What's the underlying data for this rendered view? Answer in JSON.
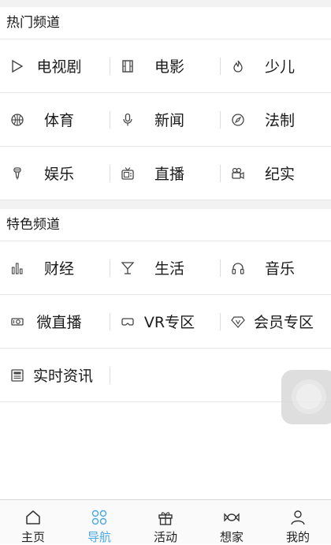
{
  "hot_section": {
    "title": "热门频道",
    "rows": [
      [
        {
          "label": "电视剧",
          "icon": "play-icon"
        },
        {
          "label": "电影",
          "icon": "film-icon"
        },
        {
          "label": "少儿",
          "icon": "flame-icon"
        }
      ],
      [
        {
          "label": "体育",
          "icon": "basketball-icon"
        },
        {
          "label": "新闻",
          "icon": "microphone-icon"
        },
        {
          "label": "法制",
          "icon": "compass-icon"
        }
      ],
      [
        {
          "label": "娱乐",
          "icon": "karaoke-mic-icon"
        },
        {
          "label": "直播",
          "icon": "tv-icon"
        },
        {
          "label": "纪实",
          "icon": "video-camera-icon"
        }
      ]
    ]
  },
  "featured_section": {
    "title": "特色频道",
    "rows": [
      [
        {
          "label": "财经",
          "icon": "bar-chart-icon"
        },
        {
          "label": "生活",
          "icon": "cocktail-glass-icon"
        },
        {
          "label": "音乐",
          "icon": "headphones-icon"
        }
      ],
      [
        {
          "label": "微直播",
          "icon": "camera-box-icon"
        },
        {
          "label": "VR专区",
          "icon": "vr-goggles-icon"
        },
        {
          "label": "会员专区",
          "icon": "vip-diamond-icon"
        }
      ],
      [
        {
          "label": "实时资讯",
          "icon": "newspaper-icon"
        }
      ]
    ]
  },
  "tabbar": {
    "tabs": [
      {
        "label": "主页",
        "icon": "home-icon",
        "active": false
      },
      {
        "label": "导航",
        "icon": "grid-circles-icon",
        "active": true
      },
      {
        "label": "活动",
        "icon": "gift-icon",
        "active": false
      },
      {
        "label": "想家",
        "icon": "candy-icon",
        "active": false
      },
      {
        "label": "我的",
        "icon": "user-icon",
        "active": false
      }
    ]
  },
  "colors": {
    "accent": "#4aa8e4",
    "text": "#1a1a1a",
    "divider": "#e6e6e6",
    "section_gap": "#f2f2f2"
  }
}
